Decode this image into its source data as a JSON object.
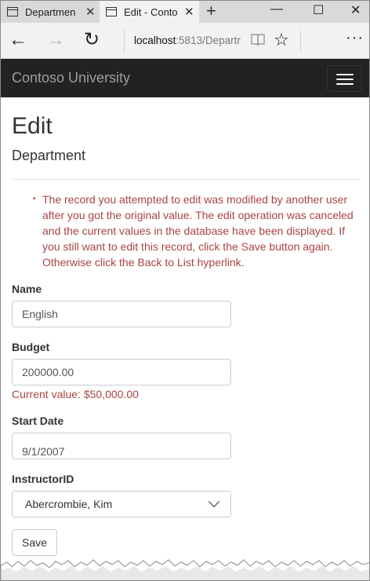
{
  "browser": {
    "tabs": [
      {
        "label": "Departmen",
        "close": "✕"
      },
      {
        "label": "Edit - Conto",
        "close": "✕"
      }
    ],
    "new_tab": "+",
    "window_controls": {
      "minimize": "—",
      "maximize": "☐",
      "close": "✕"
    },
    "back": "←",
    "forward": "→",
    "refresh": "↻",
    "address": {
      "host": "localhost",
      "path": ":5813/Departr"
    },
    "favorite": "☆",
    "more": "···"
  },
  "site": {
    "brand": "Contoso University"
  },
  "page": {
    "title": "Edit",
    "subtitle": "Department",
    "error_message": "The record you attempted to edit was modified by another user after you got the original value. The edit operation was canceled and the current values in the database have been displayed. If you still want to edit this record, click the Save button again. Otherwise click the Back to List hyperlink.",
    "bullet": "•"
  },
  "form": {
    "name": {
      "label": "Name",
      "value": "English"
    },
    "budget": {
      "label": "Budget",
      "value": "200000.00",
      "current": "Current value: $50,000.00"
    },
    "start_date": {
      "label": "Start Date",
      "value": "9/1/2007"
    },
    "instructor": {
      "label": "InstructorID",
      "selected": "Abercrombie, Kim"
    },
    "save": "Save"
  },
  "colors": {
    "error": "#a94442",
    "navbar": "#222222",
    "brand": "#9d9d9d"
  }
}
